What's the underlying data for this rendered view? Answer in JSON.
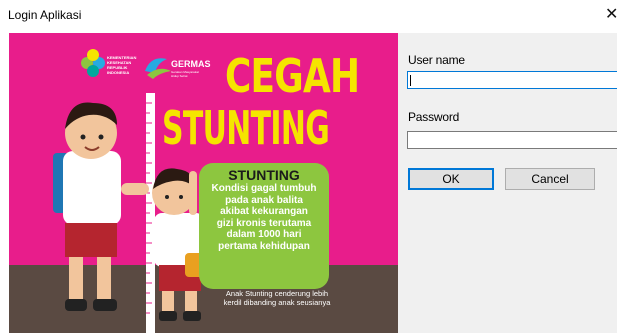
{
  "window": {
    "title": "Login Aplikasi",
    "close_glyph": "✕"
  },
  "poster": {
    "headline_1": "CEGAH",
    "headline_2": "STUNTING",
    "ministry_line_1": "KEMENTERIAN",
    "ministry_line_2": "KESEHATAN",
    "ministry_line_3": "REPUBLIK",
    "ministry_line_4": "INDONESIA",
    "germas": "GERMAS",
    "germas_tag": "Gerakan Masyarakat Hidup Sehat",
    "card_title": "STUNTING",
    "card_lines": [
      "Kondisi gagal tumbuh",
      "pada anak balita",
      "akibat kekurangan",
      "gizi kronis terutama",
      "dalam 1000 hari",
      "pertama kehidupan"
    ],
    "footer_line_1": "Anak Stunting cenderung lebih",
    "footer_line_2": "kerdil dibanding anak seusianya",
    "colors": {
      "background": "#e81d8b",
      "headline": "#f5e400",
      "card": "#8dc63f",
      "floor": "#5a4a42"
    }
  },
  "form": {
    "username_label": "User name",
    "username_value": "",
    "password_label": "Password",
    "password_value": "",
    "ok_label": "OK",
    "cancel_label": "Cancel"
  }
}
